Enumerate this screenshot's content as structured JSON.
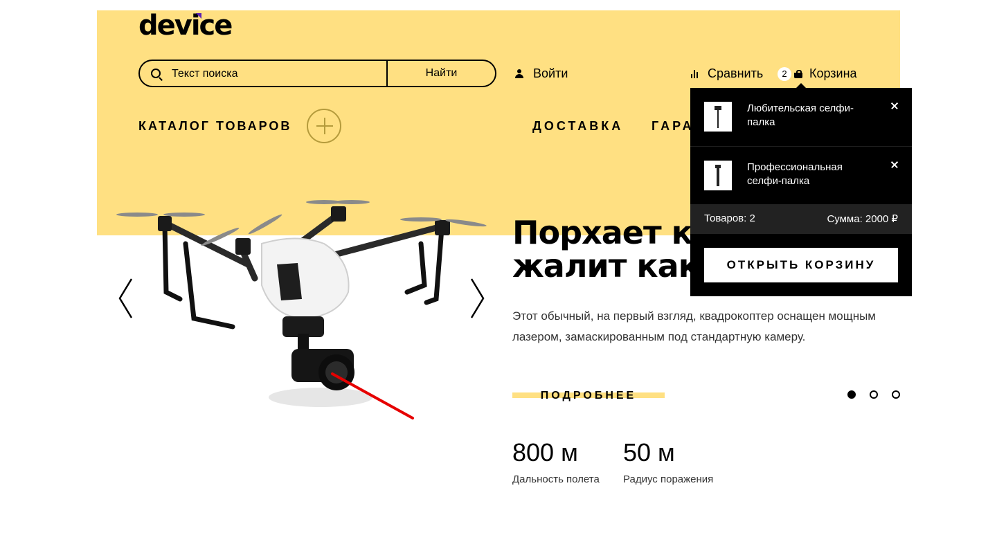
{
  "header": {
    "logo": "device",
    "search": {
      "placeholder": "Текст поиска",
      "button_label": "Найти"
    },
    "login_label": "Войти",
    "compare_label": "Сравнить",
    "cart": {
      "label": "Корзина",
      "count": "2"
    }
  },
  "nav": {
    "catalog_label": "КАТАЛОГ ТОВАРОВ",
    "items": [
      {
        "label": "ДОСТАВКА"
      },
      {
        "label": "ГАРА"
      }
    ]
  },
  "slider": {
    "headline_line1": "Порхает ка",
    "headline_line2": "жалит как",
    "description": "Этот обычный, на первый взгляд, квадрокоптер оснащен мощным лазером, замаскированным под стандартную камеру.",
    "more_label": "ПОДРОБНЕЕ",
    "active_slide": 1,
    "slide_count": 3,
    "stats": [
      {
        "value": "800 м",
        "label": "Дальность полета"
      },
      {
        "value": "50 м",
        "label": "Радиус поражения"
      }
    ]
  },
  "cart_popup": {
    "items": [
      {
        "name": "Любительская селфи-палка"
      },
      {
        "name": "Профессиональная селфи-палка"
      }
    ],
    "summary_count": "Товаров: 2",
    "summary_sum": "Сумма: 2000 ₽",
    "open_label": "ОТКРЫТЬ КОРЗИНУ"
  },
  "colors": {
    "accent_yellow": "#ffe082",
    "logo_accent": "#5d21b4",
    "laser": "#e60000",
    "popup_bg": "#000000"
  },
  "icons": {
    "search": "search-icon",
    "user": "user-icon",
    "compare": "compare-icon",
    "cart": "bag-icon",
    "plus": "plus-icon",
    "close": "close-icon",
    "prev": "chevron-left-icon",
    "next": "chevron-right-icon"
  }
}
